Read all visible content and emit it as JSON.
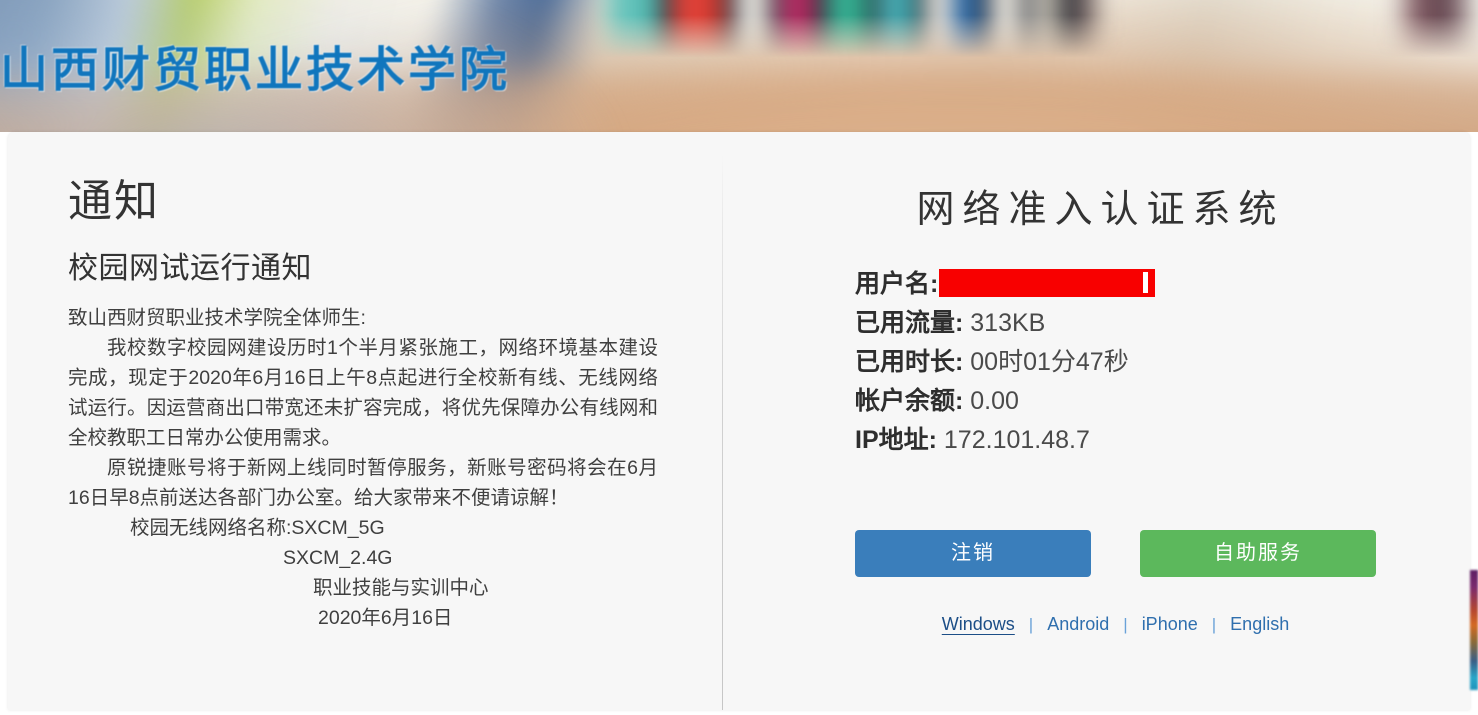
{
  "banner": {
    "school_name": "山西财贸职业技术学院"
  },
  "notice": {
    "title": "通知",
    "subtitle": "校园网试运行通知",
    "salutation": "致山西财贸职业技术学院全体师生:",
    "paragraph_1": "我校数字校园网建设历时1个半月紧张施工，网络环境基本建设完成，现定于2020年6月16日上午8点起进行全校新有线、无线网络试运行。因运营商出口带宽还未扩容完成，将优先保障办公有线网和全校教职工日常办公使用需求。",
    "paragraph_2": "原锐捷账号将于新网上线同时暂停服务，新账号密码将会在6月16日早8点前送达各部门办公室。给大家带来不便请谅解！",
    "wifi_5g": "校园无线网络名称:SXCM_5G",
    "wifi_24g": "SXCM_2.4G",
    "signature_dept": "职业技能与实训中心",
    "signature_date": "2020年6月16日"
  },
  "auth": {
    "title": "网络准入认证系统",
    "info": [
      {
        "label": "用户名:",
        "value": "",
        "redacted": true
      },
      {
        "label": "已用流量:",
        "value": "313KB",
        "redacted": false
      },
      {
        "label": "已用时长:",
        "value": "00时01分47秒",
        "redacted": false
      },
      {
        "label": "帐户余额:",
        "value": "0.00",
        "redacted": false
      },
      {
        "label": "IP地址:",
        "value": "172.101.48.7",
        "redacted": false
      }
    ],
    "buttons": {
      "logout": "注销",
      "self_service": "自助服务"
    },
    "platform_links": [
      {
        "label": "Windows",
        "active": true
      },
      {
        "label": "Android",
        "active": false
      },
      {
        "label": "iPhone",
        "active": false
      },
      {
        "label": "English",
        "active": false
      }
    ],
    "separator": "|"
  },
  "annotation": {
    "highlight_color": "#ff0000",
    "highlight_target": "Windows"
  },
  "colors": {
    "brand_blue": "#1176bd",
    "button_blue": "#3a7ebb",
    "button_green": "#5cb85c",
    "link_blue": "#2f6fae",
    "redaction_red": "#f80000",
    "card_background": "#f7f7f7"
  }
}
